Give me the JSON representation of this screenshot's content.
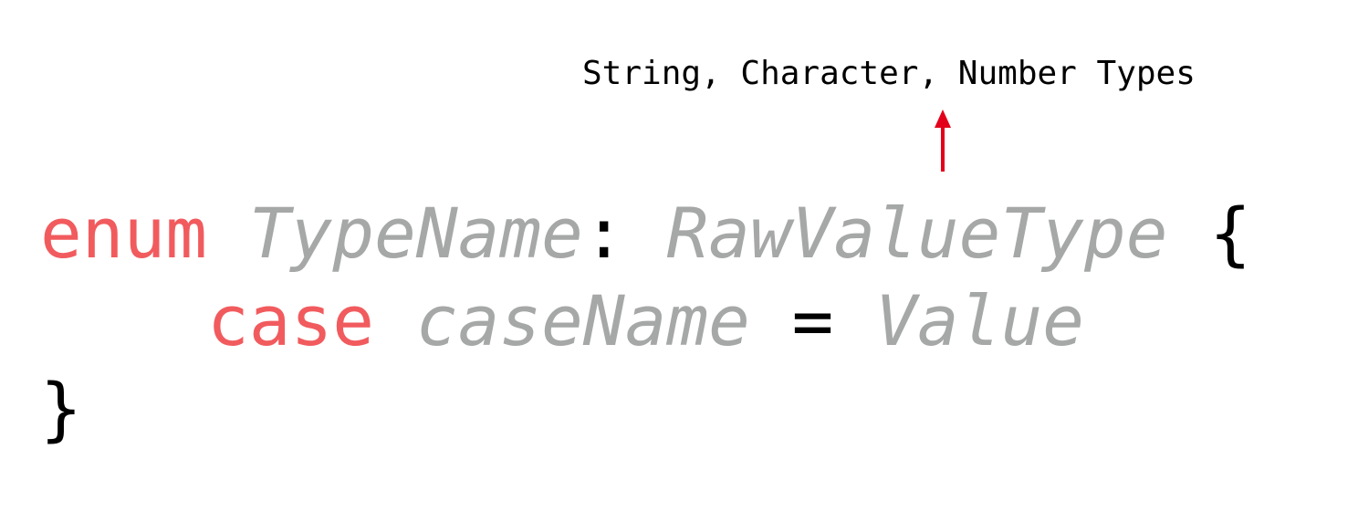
{
  "annotation": {
    "text": "String, Character, Number Types"
  },
  "code": {
    "line1": {
      "keyword": "enum",
      "type_name": "TypeName",
      "colon": ":",
      "raw_value_type": "RawValueType",
      "open_brace": "{"
    },
    "line2": {
      "indent": "    ",
      "keyword": "case",
      "case_name": "caseName",
      "equals": "=",
      "value": "Value"
    },
    "line3": {
      "close_brace": "}"
    }
  },
  "colors": {
    "keyword": "#f15b5e",
    "placeholder": "#a6a8a7",
    "symbol": "#000000",
    "arrow": "#e3001b"
  }
}
